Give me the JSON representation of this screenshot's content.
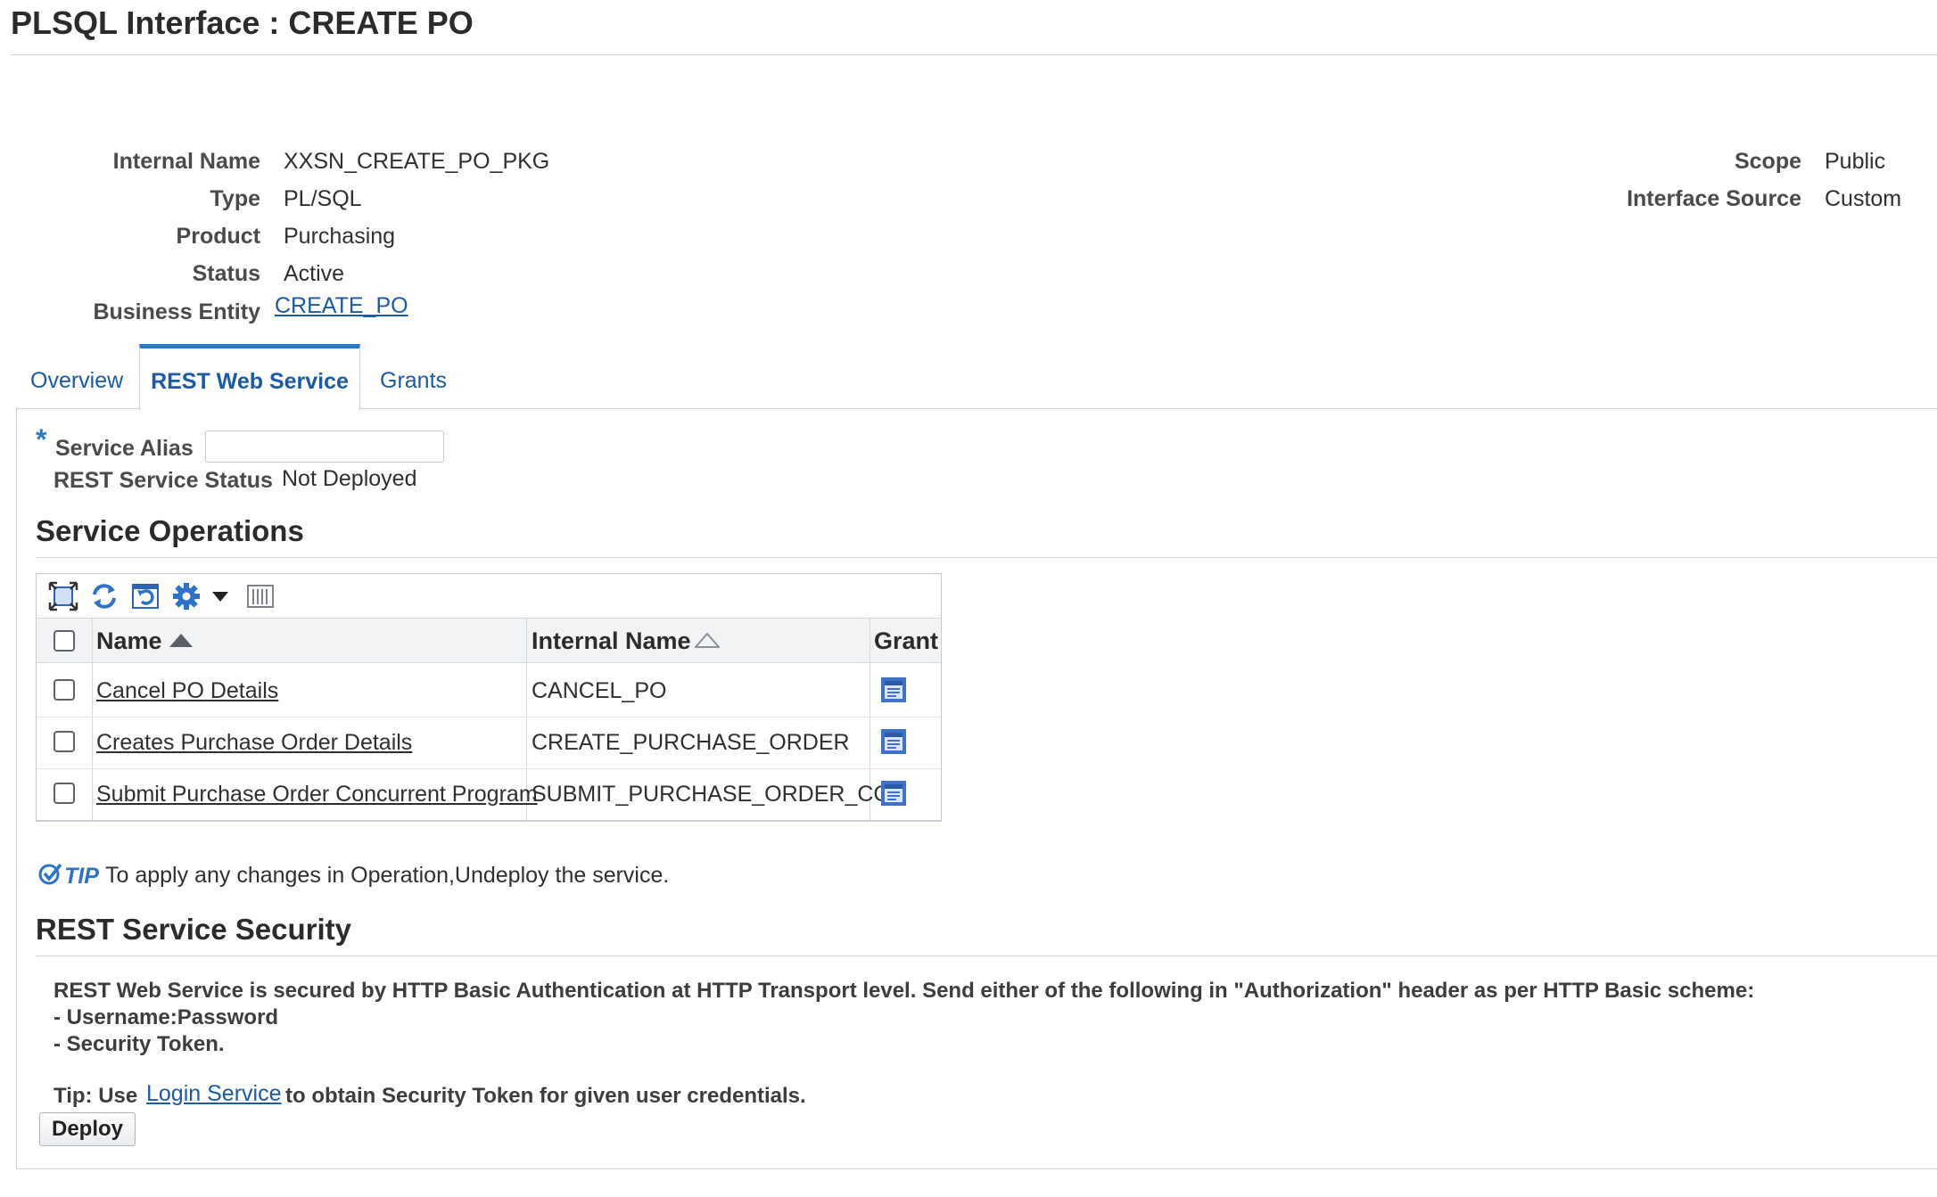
{
  "page": {
    "title": "PLSQL Interface : CREATE PO"
  },
  "details": {
    "left": [
      {
        "label": "Internal Name",
        "value": "XXSN_CREATE_PO_PKG"
      },
      {
        "label": "Type",
        "value": "PL/SQL"
      },
      {
        "label": "Product",
        "value": "Purchasing"
      },
      {
        "label": "Status",
        "value": "Active"
      },
      {
        "label": "Business Entity",
        "value": "CREATE_PO"
      }
    ],
    "right": [
      {
        "label": "Scope",
        "value": "Public"
      },
      {
        "label": "Interface Source",
        "value": "Custom"
      }
    ]
  },
  "tabs": [
    {
      "label": "Overview",
      "active": false
    },
    {
      "label": "REST Web Service",
      "active": true
    },
    {
      "label": "Grants",
      "active": false
    }
  ],
  "service": {
    "alias_label": "Service Alias",
    "alias_value": "",
    "required_mark": "*",
    "status_label": "REST Service Status",
    "status_value": "Not Deployed"
  },
  "operations": {
    "title": "Service Operations",
    "toolbar_icons": [
      "detach-icon",
      "refresh-icon",
      "revert-icon",
      "settings-icon",
      "dropdown-arrow-icon",
      "columns-icon"
    ],
    "columns": [
      {
        "label": "Name",
        "sort": "ascending"
      },
      {
        "label": "Internal Name",
        "sort": "none"
      },
      {
        "label": "Grant",
        "sort": "none"
      }
    ],
    "rows": [
      {
        "name": "Cancel PO Details",
        "internal_name": "CANCEL_PO",
        "grant_icon": "grant-icon"
      },
      {
        "name": "Creates Purchase Order Details",
        "internal_name": "CREATE_PURCHASE_ORDER",
        "grant_icon": "grant-icon"
      },
      {
        "name": "Submit Purchase Order Concurrent Program",
        "internal_name": "SUBMIT_PURCHASE_ORDER_CC",
        "grant_icon": "grant-icon"
      }
    ]
  },
  "tip": {
    "badge": "TIP",
    "text": "To apply any changes in Operation,Undeploy the service."
  },
  "security": {
    "title": "REST Service Security",
    "line1": "REST Web Service is secured by HTTP Basic Authentication at HTTP Transport level. Send either of the following in \"Authorization\" header as per HTTP Basic scheme:",
    "line2": "- Username:Password",
    "line3": "- Security Token.",
    "tip_prefix": "Tip: Use",
    "tip_link": "Login Service",
    "tip_suffix": "to obtain Security Token for given user credentials."
  },
  "actions": {
    "deploy_label": "Deploy"
  },
  "colors": {
    "accent": "#2a78c8",
    "link": "#1a5aa6",
    "grant_icon": "#3f72c8"
  }
}
